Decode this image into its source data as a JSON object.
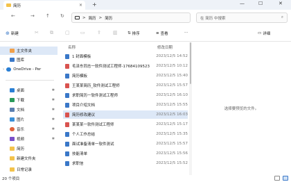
{
  "window": {
    "tab_title": "简历",
    "tab_close": "×",
    "new_tab": "+",
    "min_glyph": "—",
    "max_glyph": "☐",
    "close_glyph": "✕"
  },
  "nav": {
    "back": "←",
    "forward": "→",
    "up": "↑",
    "refresh": "↻",
    "breadcrumb_sep": ">",
    "breadcrumb": [
      "简历",
      "简历"
    ],
    "more": "›"
  },
  "search": {
    "placeholder": "在 简历 中搜索",
    "icon_glyph": "⌕"
  },
  "toolbar": {
    "new_label": "新建",
    "sort_label": "排序",
    "view_label": "查看",
    "more_label": "···",
    "details_label": "详细"
  },
  "sidebar": {
    "home": "主文件夹",
    "gallery": "图库",
    "onedrive": "OneDrive - Per",
    "desktop": "桌面",
    "downloads": "下载",
    "documents": "文档",
    "pictures": "图片",
    "music": "音乐",
    "videos": "视频",
    "folder1": "简历",
    "folder2": "新建文件夹",
    "folder3": "日常记录"
  },
  "columns": {
    "name": "名称",
    "date": "修改日期"
  },
  "files": [
    {
      "name": "1 封面模板",
      "date": "2023/12/5 14:52",
      "color": "#3a78c8"
    },
    {
      "name": "毛泽东同志一软件测试工程师-17684109523",
      "date": "2023/12/5 10:12",
      "color": "#d9534f"
    },
    {
      "name": "简历模板",
      "date": "2023/12/5 15:40",
      "color": "#3a78c8"
    },
    {
      "name": "王某某简历_软件测试工程师",
      "date": "2023/12/5 15:57",
      "color": "#d9534f"
    },
    {
      "name": "求职简历一软件测试工程师",
      "date": "2023/12/5 16:10",
      "color": "#3a78c8"
    },
    {
      "name": "项目介绍文档",
      "date": "2023/12/5 15:55",
      "color": "#3a78c8"
    },
    {
      "name": "简历修改建议",
      "date": "2023/12/5 16:03",
      "color": "#d9534f"
    },
    {
      "name": "某某某一软件测试工程师",
      "date": "2023/12/5 15:17",
      "color": "#d9534f"
    },
    {
      "name": "个人工作总结",
      "date": "2023/12/5 15:35",
      "color": "#3a78c8"
    },
    {
      "name": "面试准备清单一软件测试",
      "date": "2023/12/5 15:57",
      "color": "#3a78c8"
    },
    {
      "name": "技能清单",
      "date": "2023/12/5 15:56",
      "color": "#3a78c8"
    },
    {
      "name": "求职信",
      "date": "2023/12/5 15:52",
      "color": "#3a78c8"
    }
  ],
  "preview": {
    "message": "选择要预览的文件。"
  },
  "status": {
    "count": "20 个项目"
  }
}
